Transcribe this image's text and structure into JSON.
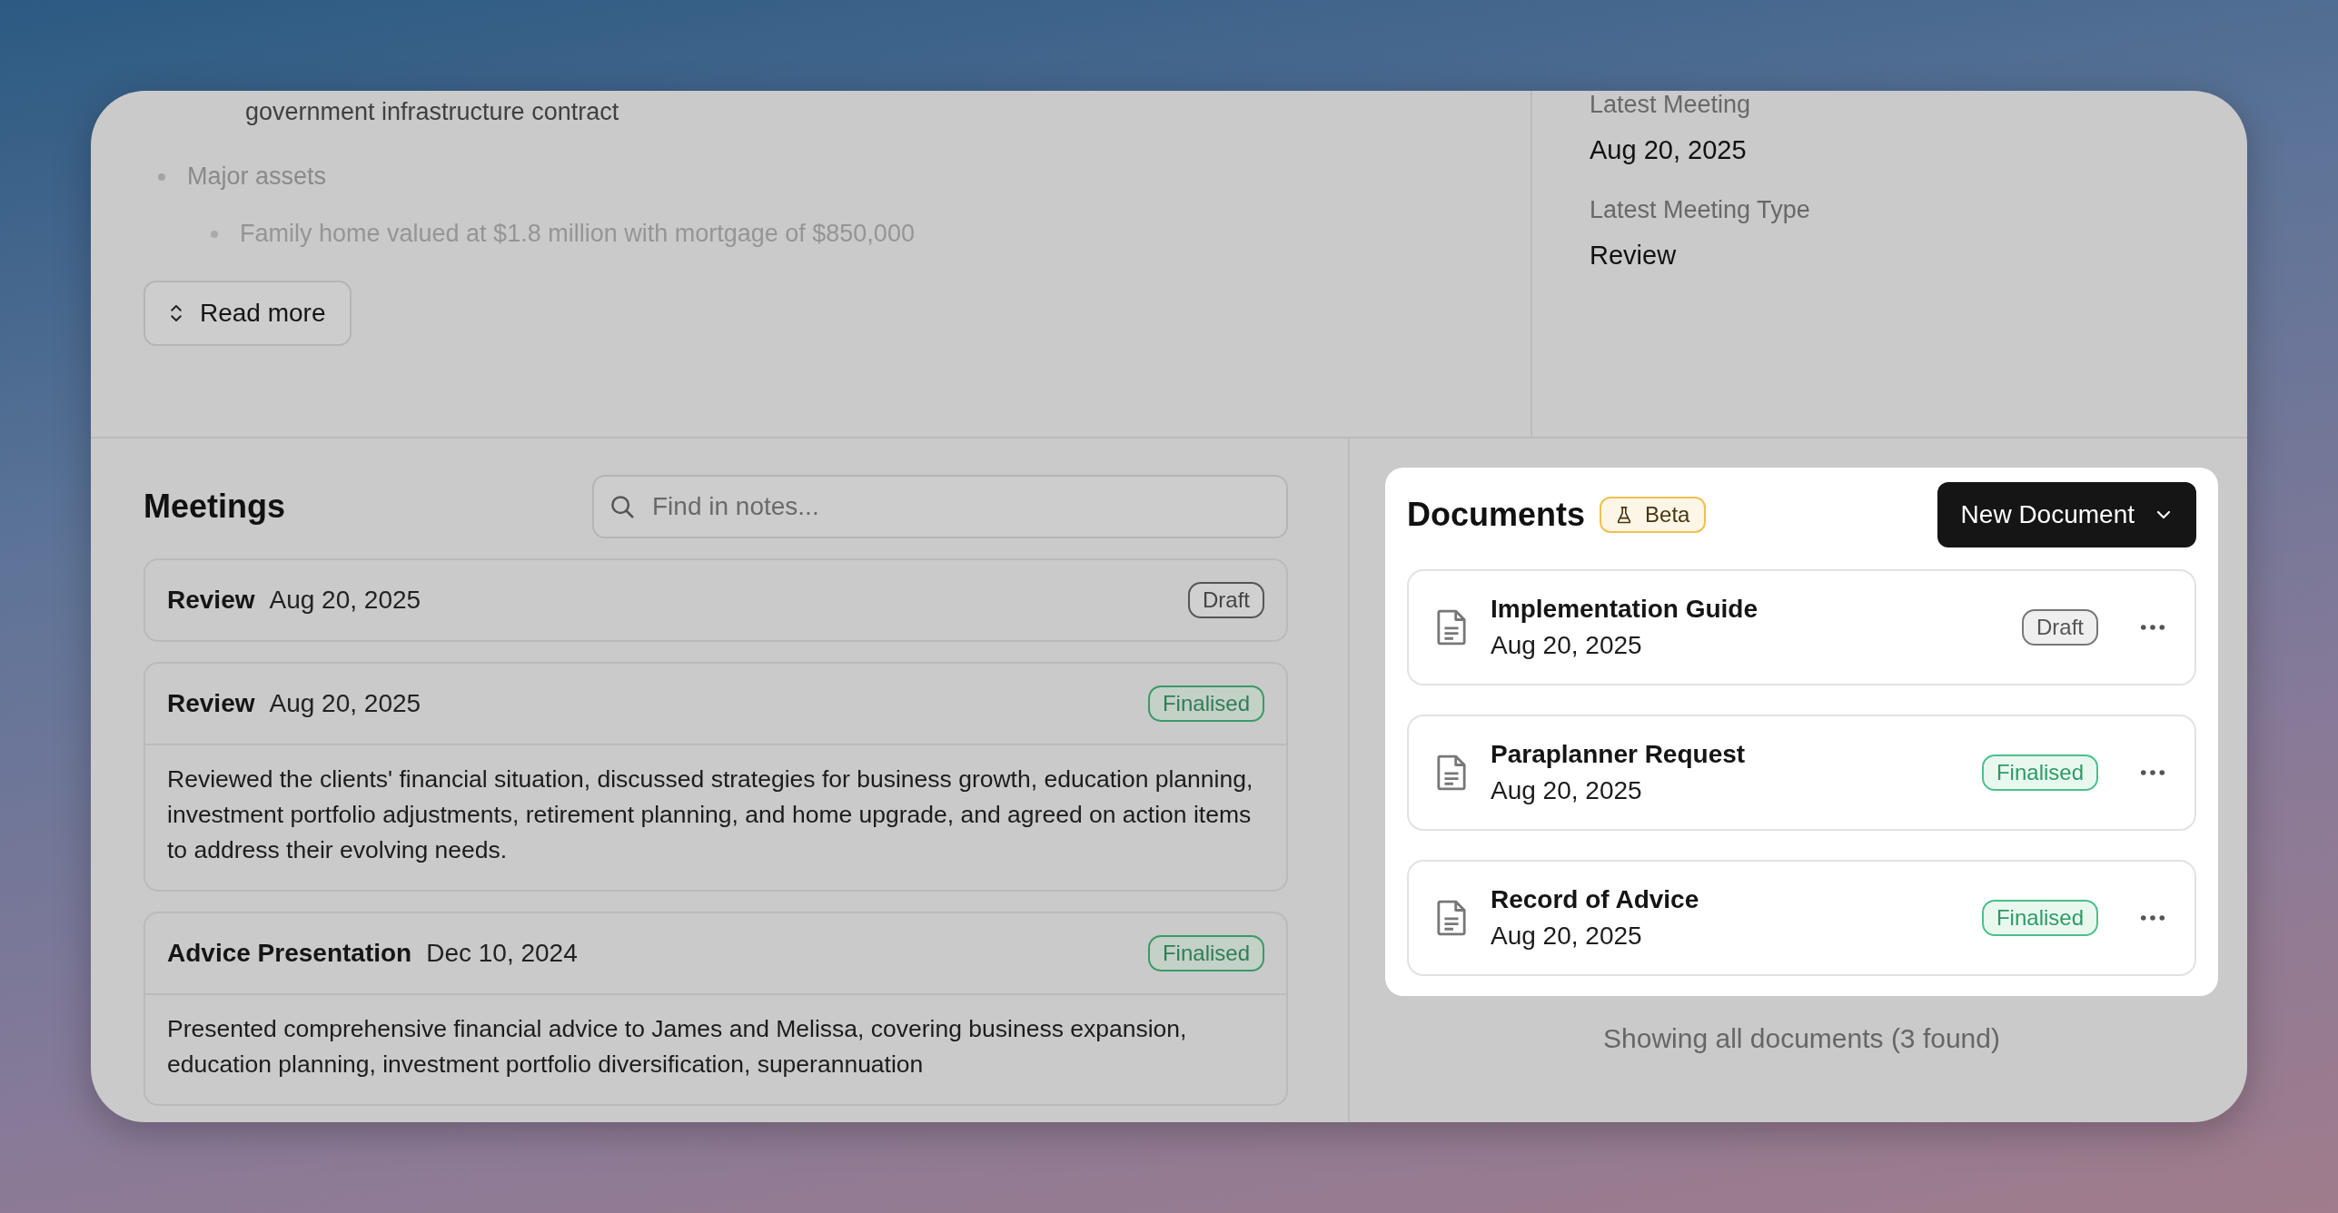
{
  "summary": {
    "lines": [
      {
        "text": "government infrastructure contract",
        "kind": "continuation"
      },
      {
        "text": "Major assets",
        "kind": "bullet"
      },
      {
        "text": "Family home valued at $1.8 million with mortgage of $850,000",
        "kind": "subbullet"
      }
    ],
    "read_more": "Read more"
  },
  "details": [
    {
      "label": "Latest Meeting",
      "value": "Aug 20, 2025"
    },
    {
      "label": "Latest Meeting Type",
      "value": "Review"
    }
  ],
  "meetings": {
    "title": "Meetings",
    "search": {
      "placeholder": "Find in notes..."
    },
    "items": [
      {
        "type": "Review",
        "date": "Aug 20, 2025",
        "status": "Draft",
        "draft": true
      },
      {
        "type": "Review",
        "date": "Aug 20, 2025",
        "status": "Finalised",
        "draft": false,
        "summary": "Reviewed the clients' financial situation, discussed strategies for business growth, education planning, investment portfolio adjustments, retirement planning, and home upgrade, and agreed on action items to address their evolving needs."
      },
      {
        "type": "Advice Presentation",
        "date": "Dec 10, 2024",
        "status": "Finalised",
        "draft": false,
        "summary": "Presented comprehensive financial advice to James and Melissa, covering business expansion, education planning, investment portfolio diversification, superannuation"
      }
    ]
  },
  "documents": {
    "title": "Documents",
    "badge": "Beta",
    "new_button": "New Document",
    "items": [
      {
        "name": "Implementation Guide",
        "date": "Aug 20, 2025",
        "status": "Draft",
        "draft": true
      },
      {
        "name": "Paraplanner Request",
        "date": "Aug 20, 2025",
        "status": "Finalised",
        "draft": false
      },
      {
        "name": "Record of Advice",
        "date": "Aug 20, 2025",
        "status": "Finalised",
        "draft": false
      }
    ],
    "footer": "Showing all documents (3 found)"
  }
}
